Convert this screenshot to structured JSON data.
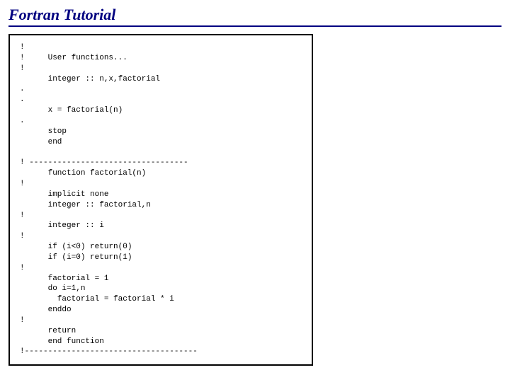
{
  "title": "Fortran Tutorial",
  "code": "!\n!     User functions...\n!\n      integer :: n,x,factorial\n.\n.\n      x = factorial(n)\n.\n      stop\n      end\n\n! ----------------------------------\n      function factorial(n)\n!\n      implicit none\n      integer :: factorial,n\n!\n      integer :: i\n!\n      if (i<0) return(0)\n      if (i=0) return(1)\n!\n      factorial = 1\n      do i=1,n\n        factorial = factorial * i\n      enddo\n!\n      return\n      end function\n!-------------------------------------"
}
